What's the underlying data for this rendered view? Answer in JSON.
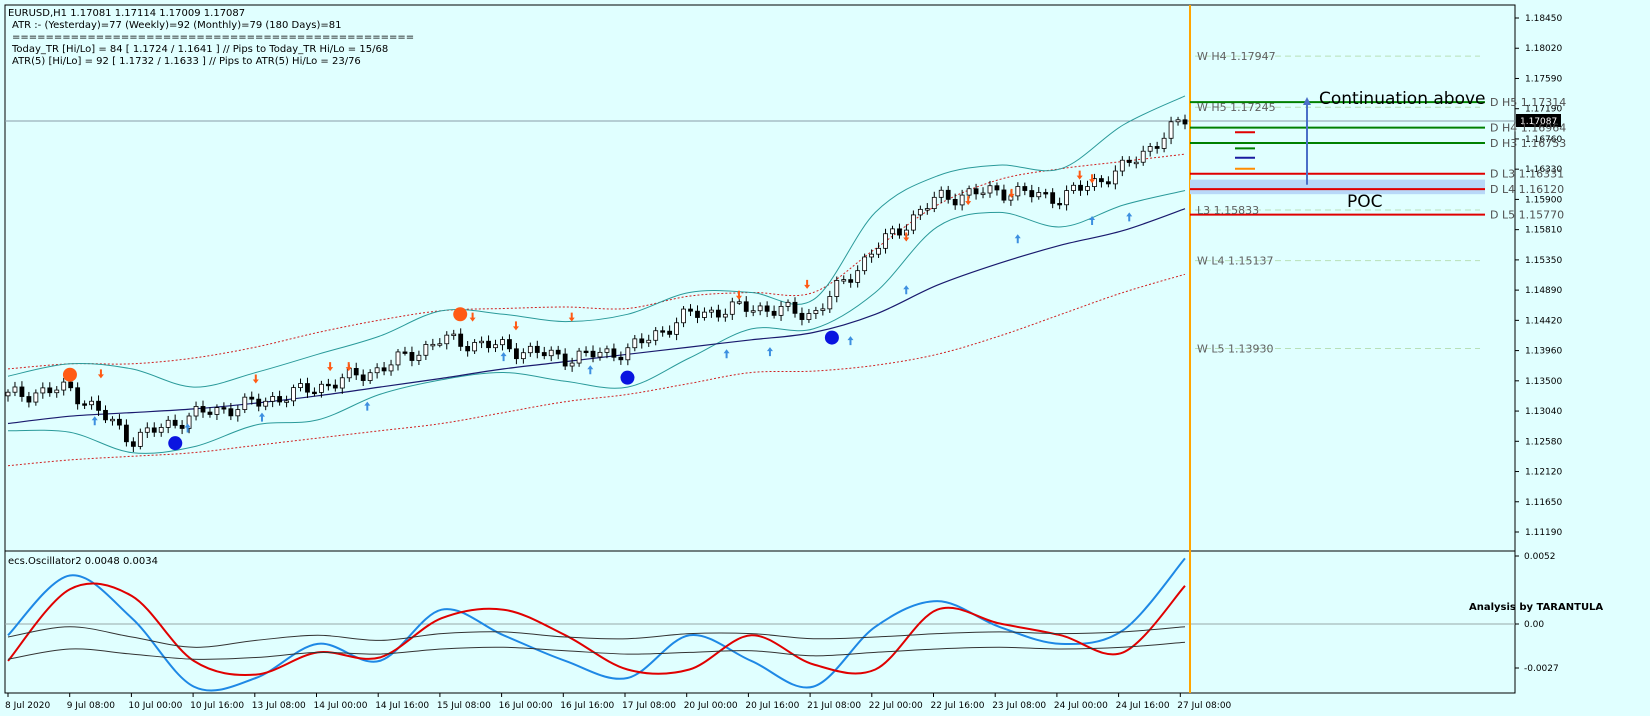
{
  "header": {
    "line1": "EURUSD,H1  1.17081 1.17114 1.17009 1.17087",
    "line2": "ATR :- (Yesterday)=77      (Weekly)=92      (Monthly)=79      (180 Days)=81",
    "line3": "================================================",
    "line4": "Today_TR [Hi/Lo] = 84 [ 1.1724 / 1.1641 ]  // Pips to Today_TR Hi/Lo  = 15/68",
    "line5": "ATR(5)      [Hi/Lo] = 92 [ 1.1732 / 1.1633 ]  //  Pips to ATR(5) Hi/Lo      = 23/76"
  },
  "annotations": {
    "continuation": "Continuation above",
    "poc": "POC",
    "oscillator_title": "ecs.Oscillator2 0.0048 0.0034",
    "analysis_credit": "Analysis by TARANTULA"
  },
  "colors": {
    "background": "#e0ffff",
    "frame": "#000000",
    "green_level": "#008000",
    "red_level": "#e00000",
    "vline": "#ffa500",
    "poc_zone": "#b8d8f8",
    "arrow": "#4a6fc8",
    "bb": "#2a9a9a",
    "env": "#d02020",
    "ma": "#1a1a6e",
    "osc_blue": "#1e88e5",
    "osc_red": "#e00000",
    "dot_blue": "#0a14e0",
    "dot_orange": "#ff5a14"
  },
  "price_scale_labels": [
    "1.18450",
    "1.18020",
    "1.17590",
    "1.17190",
    "1.16760",
    "1.16330",
    "1.15900",
    "1.15810",
    "1.15350",
    "1.14890",
    "1.14420",
    "1.13960",
    "1.13500",
    "1.13040",
    "1.12580",
    "1.12120",
    "1.11650",
    "1.11190"
  ],
  "current_price": "1.17087",
  "osc_scale_labels": [
    "0.0052",
    "0.00",
    "-0.0027"
  ],
  "time_labels": [
    "8 Jul 2020",
    "9 Jul 08:00",
    "10 Jul 00:00",
    "10 Jul 16:00",
    "13 Jul 08:00",
    "14 Jul 00:00",
    "14 Jul 16:00",
    "15 Jul 08:00",
    "16 Jul 00:00",
    "16 Jul 16:00",
    "17 Jul 08:00",
    "20 Jul 00:00",
    "20 Jul 16:00",
    "21 Jul 08:00",
    "22 Jul 00:00",
    "22 Jul 16:00",
    "23 Jul 08:00",
    "24 Jul 00:00",
    "24 Jul 16:00",
    "27 Jul 08:00"
  ],
  "levels": [
    {
      "label": "W  H4 1.17947",
      "value": 1.17947,
      "kind": "weekly"
    },
    {
      "label": "W  H5 1.17245",
      "value": 1.17245,
      "kind": "weekly"
    },
    {
      "label": "D  H5 1.17314",
      "value": 1.17314,
      "kind": "daily-green"
    },
    {
      "label": "D  H4 1.16964",
      "value": 1.16964,
      "kind": "daily-green"
    },
    {
      "label": "D  H3 1.16753",
      "value": 1.16753,
      "kind": "daily-green"
    },
    {
      "label": "D  L3 1.16331",
      "value": 1.16331,
      "kind": "daily-red"
    },
    {
      "label": "D  L4 1.16120",
      "value": 1.1612,
      "kind": "daily-red"
    },
    {
      "label": "D  L5 1.15770",
      "value": 1.1577,
      "kind": "daily-red"
    },
    {
      "label": "L3 1.15833",
      "value": 1.15833,
      "kind": "weekly"
    },
    {
      "label": "W  L4 1.15137",
      "value": 1.15137,
      "kind": "weekly"
    },
    {
      "label": "W  L5 1.13930",
      "value": 1.1393,
      "kind": "weekly"
    }
  ],
  "chart_data": {
    "type": "line",
    "symbol": "EURUSD",
    "timeframe": "H1",
    "ylim": [
      1.1119,
      1.1858
    ],
    "osc_ylim": [
      -0.0027,
      0.0052
    ],
    "x": [
      "8 Jul 2020",
      "9 Jul 08:00",
      "10 Jul 00:00",
      "10 Jul 16:00",
      "13 Jul 08:00",
      "14 Jul 00:00",
      "14 Jul 16:00",
      "15 Jul 08:00",
      "16 Jul 00:00",
      "16 Jul 16:00",
      "17 Jul 08:00",
      "20 Jul 00:00",
      "20 Jul 16:00",
      "21 Jul 08:00",
      "22 Jul 00:00",
      "22 Jul 16:00",
      "23 Jul 08:00",
      "24 Jul 00:00",
      "24 Jul 16:00",
      "27 Jul 08:00"
    ],
    "series": [
      {
        "name": "close",
        "values": [
          1.1328,
          1.1338,
          1.1268,
          1.1302,
          1.1318,
          1.134,
          1.1365,
          1.1405,
          1.1395,
          1.138,
          1.139,
          1.144,
          1.145,
          1.144,
          1.153,
          1.16,
          1.161,
          1.16,
          1.164,
          1.1708
        ]
      },
      {
        "name": "bb_upper",
        "values": [
          1.1355,
          1.1372,
          1.1365,
          1.134,
          1.136,
          1.1385,
          1.141,
          1.1445,
          1.144,
          1.143,
          1.144,
          1.147,
          1.147,
          1.146,
          1.158,
          1.163,
          1.1645,
          1.164,
          1.17,
          1.174
        ]
      },
      {
        "name": "bb_lower",
        "values": [
          1.128,
          1.1278,
          1.125,
          1.1258,
          1.1288,
          1.1295,
          1.133,
          1.135,
          1.136,
          1.1348,
          1.134,
          1.138,
          1.142,
          1.142,
          1.147,
          1.156,
          1.158,
          1.156,
          1.159,
          1.161
        ]
      },
      {
        "name": "ma",
        "values": [
          1.129,
          1.13,
          1.1305,
          1.131,
          1.1318,
          1.1328,
          1.134,
          1.1352,
          1.1365,
          1.1375,
          1.1385,
          1.1395,
          1.1405,
          1.1415,
          1.144,
          1.148,
          1.151,
          1.1535,
          1.1555,
          1.1585
        ]
      },
      {
        "name": "env_upper",
        "values": [
          1.1365,
          1.1372,
          1.1372,
          1.138,
          1.1395,
          1.1415,
          1.1432,
          1.1445,
          1.1448,
          1.145,
          1.1448,
          1.1465,
          1.147,
          1.147,
          1.153,
          1.159,
          1.1625,
          1.164,
          1.165,
          1.166
        ]
      },
      {
        "name": "env_lower",
        "values": [
          1.1232,
          1.124,
          1.1245,
          1.125,
          1.126,
          1.127,
          1.128,
          1.129,
          1.1305,
          1.132,
          1.133,
          1.1345,
          1.136,
          1.1362,
          1.137,
          1.1385,
          1.141,
          1.144,
          1.147,
          1.1495
        ]
      }
    ],
    "oscillator": {
      "name": "ecs.Oscillator2",
      "values_shown": [
        0.0048,
        0.0034
      ],
      "series": [
        {
          "name": "blue",
          "values": [
            0.0005,
            0.004,
            0.0015,
            -0.0025,
            -0.002,
            0.0,
            -0.001,
            0.002,
            0.0005,
            -0.001,
            -0.002,
            0.0005,
            -0.001,
            -0.0025,
            0.001,
            0.0025,
            0.001,
            0.0,
            0.0008,
            0.005
          ]
        },
        {
          "name": "red",
          "values": [
            -0.001,
            0.0032,
            0.0028,
            -0.001,
            -0.0018,
            -0.0005,
            -0.0008,
            0.0015,
            0.002,
            0.0005,
            -0.0015,
            -0.0015,
            0.0005,
            -0.0012,
            -0.0015,
            0.002,
            0.0012,
            0.0005,
            -0.0005,
            0.0034
          ]
        },
        {
          "name": "signal-up",
          "values": [
            0.0004,
            0.001,
            0.0004,
            -0.0002,
            0.0002,
            0.0005,
            0.0002,
            0.0006,
            0.0007,
            0.0004,
            0.0003,
            0.0006,
            0.0006,
            0.0003,
            0.0004,
            0.0006,
            0.0007,
            0.0006,
            0.0007,
            0.001
          ]
        },
        {
          "name": "signal-down",
          "values": [
            -0.0009,
            -0.0003,
            -0.0006,
            -0.0009,
            -0.0008,
            -0.0005,
            -0.0006,
            -0.0003,
            -0.0002,
            -0.0004,
            -0.0006,
            -0.0005,
            -0.0004,
            -0.0007,
            -0.0005,
            -0.0003,
            -0.0002,
            -0.0003,
            -0.0002,
            0.0001
          ]
        }
      ]
    },
    "signals": [
      {
        "type": "dot-orange",
        "x": 1,
        "y": 1.1357
      },
      {
        "type": "dot-blue",
        "x": 2.7,
        "y": 1.1263
      },
      {
        "type": "dot-orange",
        "x": 7.3,
        "y": 1.144
      },
      {
        "type": "dot-blue",
        "x": 10.0,
        "y": 1.1353
      },
      {
        "type": "dot-blue",
        "x": 13.3,
        "y": 1.1408
      }
    ],
    "poc_zone": [
      1.1605,
      1.1625
    ],
    "continuation_arrow": {
      "from": 1.1618,
      "to": 1.1733
    }
  }
}
